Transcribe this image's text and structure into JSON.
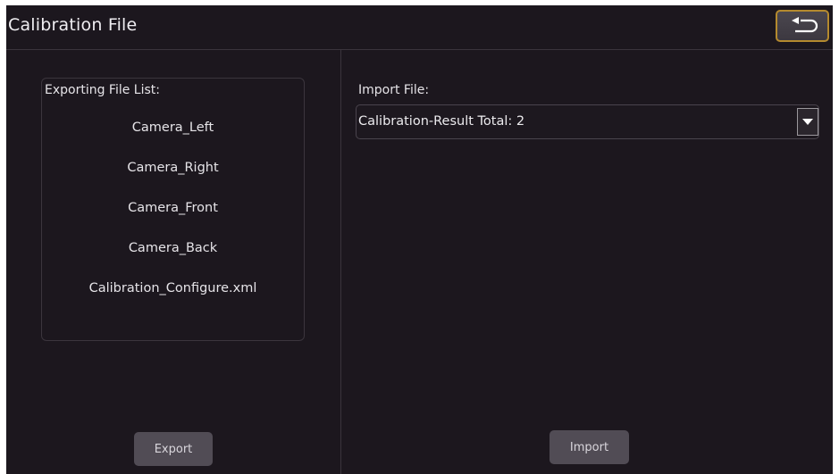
{
  "header": {
    "title": "Calibration File",
    "back_icon": "back-arrow-icon"
  },
  "export_panel": {
    "list_title": "Exporting File List:",
    "files": [
      "Camera_Left",
      "Camera_Right",
      "Camera_Front",
      "Camera_Back",
      "Calibration_Configure.xml"
    ],
    "export_label": "Export"
  },
  "import_panel": {
    "label": "Import File:",
    "selected_file": "Calibration-Result Total: 2",
    "dropdown_icon": "chevron-down-icon",
    "import_label": "Import"
  },
  "colors": {
    "background": "#1c171e",
    "button": "#514c55",
    "back_button_border": "#b48a2e",
    "text": "#e8e6ea"
  }
}
